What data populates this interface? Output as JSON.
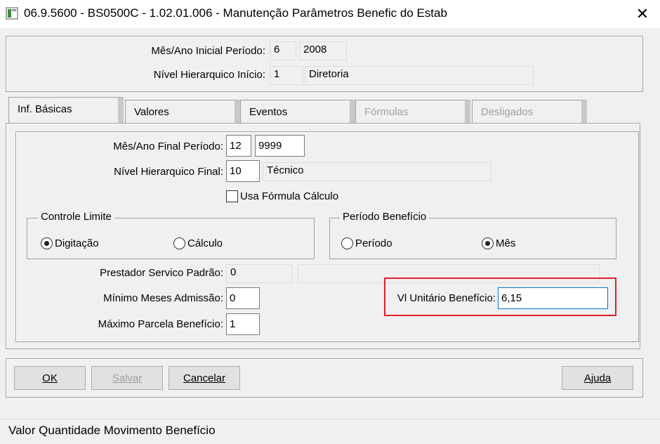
{
  "window": {
    "title": "06.9.5600 - BS0500C - 1.02.01.006 - Manutenção Parâmetros Benefic do Estab",
    "close_glyph": "✕"
  },
  "header": {
    "mes_ano_inicial": {
      "label": "Mês/Ano Inicial Período:",
      "mes": "6",
      "ano": "2008"
    },
    "nivel_inicio": {
      "label": "Nível Hierarquico Início:",
      "codigo": "1",
      "descricao": "Diretoria"
    }
  },
  "tabs": [
    {
      "label": "Inf. Básicas",
      "active": true,
      "enabled": true
    },
    {
      "label": "Valores",
      "active": false,
      "enabled": true
    },
    {
      "label": "Eventos",
      "active": false,
      "enabled": true
    },
    {
      "label": "Fórmulas",
      "active": false,
      "enabled": false
    },
    {
      "label": "Desligados",
      "active": false,
      "enabled": false
    }
  ],
  "basicas": {
    "mes_ano_final": {
      "label": "Mês/Ano Final Período:",
      "mes": "12",
      "ano": "9999"
    },
    "nivel_final": {
      "label": "Nível Hierarquico Final:",
      "codigo": "10",
      "descricao": "Técnico"
    },
    "usa_formula": {
      "label": "Usa Fórmula Cálculo",
      "checked": false
    },
    "controle_limite": {
      "title": "Controle Limite",
      "options": [
        "Digitação",
        "Cálculo"
      ],
      "selected": "Digitação"
    },
    "periodo_beneficio": {
      "title": "Período Benefício",
      "options": [
        "Período",
        "Mês"
      ],
      "selected": "Mês"
    },
    "prestador": {
      "label": "Prestador Servico Padrão:",
      "codigo": "0",
      "descricao": ""
    },
    "minimo_meses": {
      "label": "Mínimo Meses Admissão:",
      "value": "0"
    },
    "maximo_parcela": {
      "label": "Máximo Parcela Benefício:",
      "value": "1"
    },
    "vl_unitario": {
      "label": "Vl Unitário Benefício:",
      "value": "6,15"
    }
  },
  "buttons": {
    "ok": "OK",
    "salvar": "Salvar",
    "cancelar": "Cancelar",
    "ajuda": "Ajuda"
  },
  "status": {
    "text": "Valor Quantidade Movimento Benefício"
  },
  "colors": {
    "highlight": "#e0202a",
    "focus": "#0078d7"
  }
}
